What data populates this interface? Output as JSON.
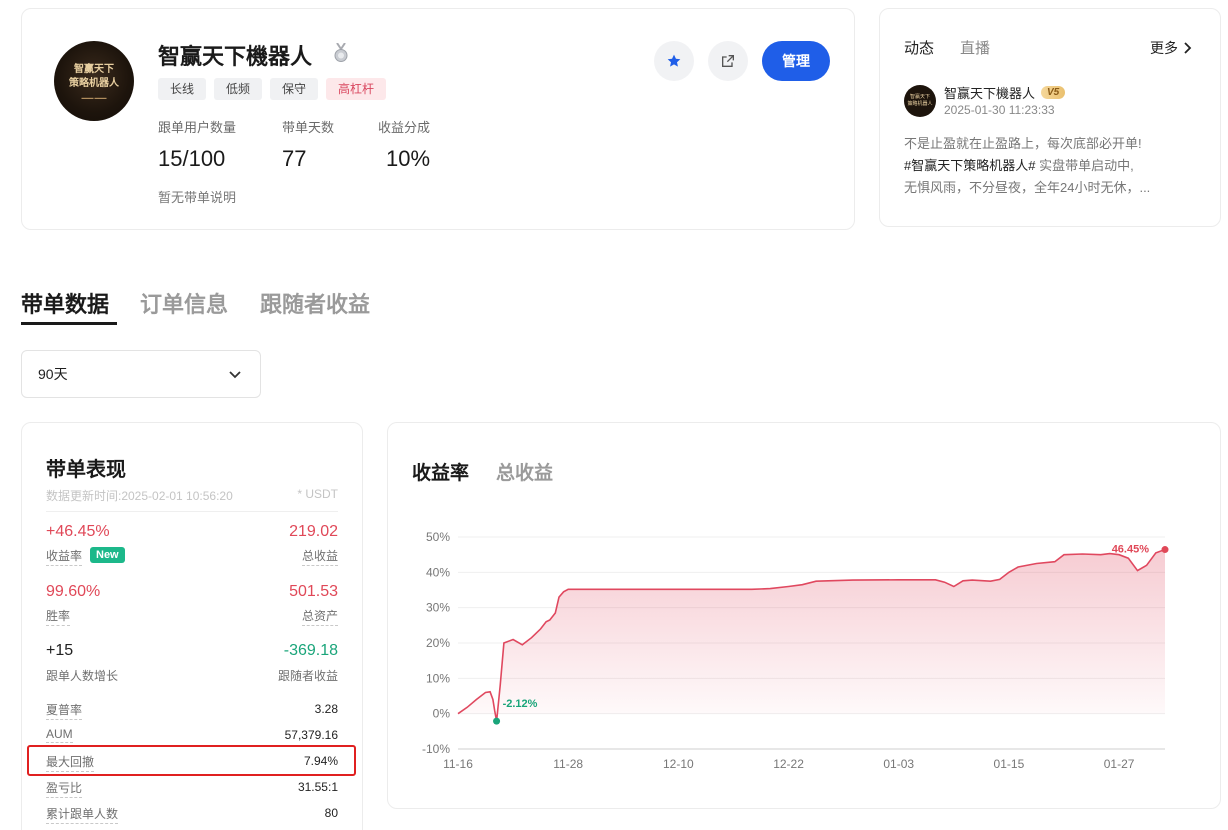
{
  "profile": {
    "avatar_text_line1": "智赢天下",
    "avatar_text_line2": "策略机器人",
    "name": "智赢天下機器人",
    "tags": [
      "长线",
      "低频",
      "保守",
      "高杠杆"
    ],
    "stats": [
      {
        "label": "跟单用户数量",
        "value": "15/100"
      },
      {
        "label": "带单天数",
        "value": "77"
      },
      {
        "label": "收益分成",
        "value": "10%"
      }
    ],
    "description": "暂无带单说明",
    "manage_label": "管理"
  },
  "feed": {
    "tabs": [
      "动态",
      "直播"
    ],
    "more_label": "更多",
    "post": {
      "author": "智赢天下機器人",
      "badge": "V5",
      "time": "2025-01-30 11:23:33",
      "line1": "不是止盈就在止盈路上，每次底部必开单!",
      "hashtag": "#智赢天下策略机器人#",
      "line2_rest": " 实盘带单启动中,",
      "line3": "无惧风雨，不分昼夜，全年24小时无休，..."
    }
  },
  "main_tabs": [
    "带单数据",
    "订单信息",
    "跟随者收益"
  ],
  "period_select": {
    "value": "90天"
  },
  "performance": {
    "title": "带单表现",
    "updated": "数据更新时间:2025-02-01 10:56:20",
    "unit": "* USDT",
    "roi": {
      "value": "+46.45%",
      "label": "收益率",
      "badge": "New"
    },
    "total_pnl": {
      "value": "219.02",
      "label": "总收益"
    },
    "win_rate": {
      "value": "99.60%",
      "label": "胜率"
    },
    "total_assets": {
      "value": "501.53",
      "label": "总资产"
    },
    "follower_growth": {
      "value": "+15",
      "label": "跟单人数增长"
    },
    "follower_pnl": {
      "value": "-369.18",
      "label": "跟随者收益"
    },
    "rows": [
      {
        "label": "夏普率",
        "value": "3.28"
      },
      {
        "label": "AUM",
        "value": "57,379.16"
      },
      {
        "label": "最大回撤",
        "value": "7.94%"
      },
      {
        "label": "盈亏比",
        "value": "31.55:1"
      },
      {
        "label": "累计跟单人数",
        "value": "80"
      }
    ]
  },
  "chart_tabs": [
    "收益率",
    "总收益"
  ],
  "colors": {
    "accent_blue": "#1f5ee8",
    "loss_red": "#e04858",
    "gain_green": "#1aa57a",
    "line": "#e0485f"
  },
  "chart_data": {
    "type": "area",
    "ylim": [
      -10,
      50
    ],
    "y_ticks": [
      "50%",
      "40%",
      "30%",
      "20%",
      "10%",
      "0%",
      "-10%"
    ],
    "x_ticks": [
      "11-16",
      "11-28",
      "12-10",
      "12-22",
      "01-03",
      "01-15",
      "01-27"
    ],
    "x_tick_values": [
      0,
      12,
      24,
      36,
      48,
      60,
      72
    ],
    "x": [
      0,
      1,
      2,
      3,
      3.5,
      3.8,
      4,
      4.2,
      4.6,
      5,
      6,
      7,
      8,
      9,
      9.6,
      10,
      10.6,
      11,
      11.5,
      12,
      14,
      20,
      26,
      32,
      34,
      36,
      37.5,
      39,
      43,
      48,
      52,
      53,
      54,
      55,
      56,
      58,
      59,
      60,
      61,
      63,
      65,
      66,
      68,
      70,
      71,
      72,
      73,
      74,
      75,
      76,
      77
    ],
    "y": [
      0,
      1.8,
      4,
      6,
      6.2,
      4,
      0.8,
      -2.12,
      8,
      20,
      21,
      19.5,
      21.5,
      24,
      26,
      26.5,
      28.5,
      33,
      34.5,
      35.2,
      35.2,
      35.2,
      35.2,
      35.2,
      35.4,
      36,
      36.5,
      37.5,
      37.8,
      37.9,
      37.9,
      37.2,
      36,
      37.6,
      37.8,
      37.5,
      38,
      40,
      41.5,
      42.5,
      43,
      45,
      45.2,
      45,
      45.3,
      45,
      44,
      40.5,
      42,
      45.5,
      46.45
    ],
    "annotations": [
      {
        "label": "-2.12%",
        "x": 4.2,
        "y": -2.12
      },
      {
        "label": "46.45%",
        "x": 77,
        "y": 46.45
      }
    ]
  }
}
